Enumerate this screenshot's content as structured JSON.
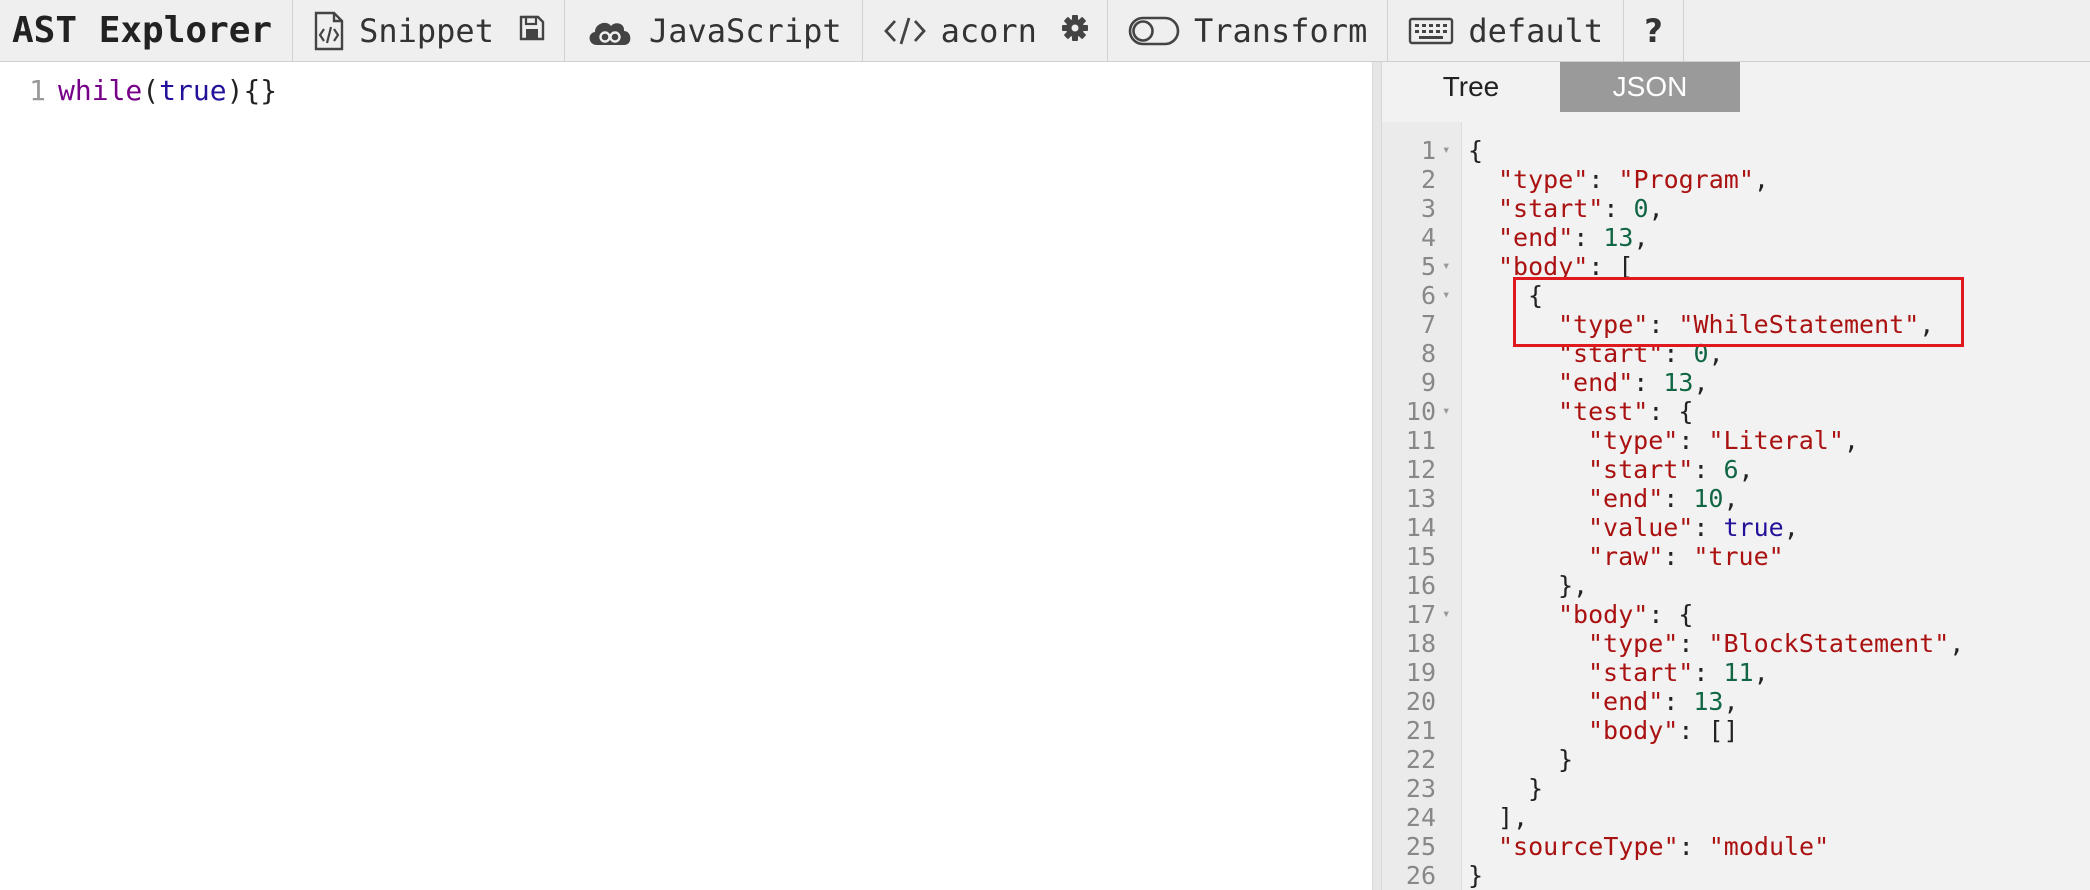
{
  "toolbar": {
    "brand": "AST Explorer",
    "snippet_label": "Snippet",
    "language_label": "JavaScript",
    "parser_label": "acorn",
    "transform_label": "Transform",
    "keymap_label": "default",
    "help_label": "?",
    "icons": [
      "file-code-icon",
      "save-icon",
      "cloud-icon",
      "code-brackets-icon",
      "gear-icon",
      "toggle-icon",
      "keyboard-icon",
      "help-icon"
    ]
  },
  "editor": {
    "lines": [
      {
        "number": "1",
        "tokens": [
          {
            "text": "while",
            "kind": "keyword"
          },
          {
            "text": "(",
            "kind": "punc"
          },
          {
            "text": "true",
            "kind": "atom"
          },
          {
            "text": "){}",
            "kind": "punc"
          }
        ]
      }
    ]
  },
  "output": {
    "tabs": [
      {
        "label": "Tree",
        "active": false
      },
      {
        "label": "JSON",
        "active": true
      }
    ],
    "json_lines": [
      {
        "n": "1",
        "fold": true,
        "indent": 0,
        "parts": [
          [
            "{",
            "p"
          ]
        ]
      },
      {
        "n": "2",
        "fold": false,
        "indent": 1,
        "parts": [
          [
            "\"type\"",
            "k"
          ],
          [
            ": ",
            "p"
          ],
          [
            "\"Program\"",
            "s"
          ],
          [
            ",",
            "p"
          ]
        ]
      },
      {
        "n": "3",
        "fold": false,
        "indent": 1,
        "parts": [
          [
            "\"start\"",
            "k"
          ],
          [
            ": ",
            "p"
          ],
          [
            "0",
            "n"
          ],
          [
            ",",
            "p"
          ]
        ]
      },
      {
        "n": "4",
        "fold": false,
        "indent": 1,
        "parts": [
          [
            "\"end\"",
            "k"
          ],
          [
            ": ",
            "p"
          ],
          [
            "13",
            "n"
          ],
          [
            ",",
            "p"
          ]
        ]
      },
      {
        "n": "5",
        "fold": true,
        "indent": 1,
        "parts": [
          [
            "\"body\"",
            "k"
          ],
          [
            ": [",
            "p"
          ]
        ]
      },
      {
        "n": "6",
        "fold": true,
        "indent": 2,
        "parts": [
          [
            "{",
            "p"
          ]
        ]
      },
      {
        "n": "7",
        "fold": false,
        "indent": 3,
        "parts": [
          [
            "\"type\"",
            "k"
          ],
          [
            ": ",
            "p"
          ],
          [
            "\"WhileStatement\"",
            "s"
          ],
          [
            ",",
            "p"
          ]
        ]
      },
      {
        "n": "8",
        "fold": false,
        "indent": 3,
        "parts": [
          [
            "\"start\"",
            "k"
          ],
          [
            ": ",
            "p"
          ],
          [
            "0",
            "n"
          ],
          [
            ",",
            "p"
          ]
        ]
      },
      {
        "n": "9",
        "fold": false,
        "indent": 3,
        "parts": [
          [
            "\"end\"",
            "k"
          ],
          [
            ": ",
            "p"
          ],
          [
            "13",
            "n"
          ],
          [
            ",",
            "p"
          ]
        ]
      },
      {
        "n": "10",
        "fold": true,
        "indent": 3,
        "parts": [
          [
            "\"test\"",
            "k"
          ],
          [
            ": {",
            "p"
          ]
        ]
      },
      {
        "n": "11",
        "fold": false,
        "indent": 4,
        "parts": [
          [
            "\"type\"",
            "k"
          ],
          [
            ": ",
            "p"
          ],
          [
            "\"Literal\"",
            "s"
          ],
          [
            ",",
            "p"
          ]
        ]
      },
      {
        "n": "12",
        "fold": false,
        "indent": 4,
        "parts": [
          [
            "\"start\"",
            "k"
          ],
          [
            ": ",
            "p"
          ],
          [
            "6",
            "n"
          ],
          [
            ",",
            "p"
          ]
        ]
      },
      {
        "n": "13",
        "fold": false,
        "indent": 4,
        "parts": [
          [
            "\"end\"",
            "k"
          ],
          [
            ": ",
            "p"
          ],
          [
            "10",
            "n"
          ],
          [
            ",",
            "p"
          ]
        ]
      },
      {
        "n": "14",
        "fold": false,
        "indent": 4,
        "parts": [
          [
            "\"value\"",
            "k"
          ],
          [
            ": ",
            "p"
          ],
          [
            "true",
            "a"
          ],
          [
            ",",
            "p"
          ]
        ]
      },
      {
        "n": "15",
        "fold": false,
        "indent": 4,
        "parts": [
          [
            "\"raw\"",
            "k"
          ],
          [
            ": ",
            "p"
          ],
          [
            "\"true\"",
            "s"
          ]
        ]
      },
      {
        "n": "16",
        "fold": false,
        "indent": 3,
        "parts": [
          [
            "},",
            "p"
          ]
        ]
      },
      {
        "n": "17",
        "fold": true,
        "indent": 3,
        "parts": [
          [
            "\"body\"",
            "k"
          ],
          [
            ": {",
            "p"
          ]
        ]
      },
      {
        "n": "18",
        "fold": false,
        "indent": 4,
        "parts": [
          [
            "\"type\"",
            "k"
          ],
          [
            ": ",
            "p"
          ],
          [
            "\"BlockStatement\"",
            "s"
          ],
          [
            ",",
            "p"
          ]
        ]
      },
      {
        "n": "19",
        "fold": false,
        "indent": 4,
        "parts": [
          [
            "\"start\"",
            "k"
          ],
          [
            ": ",
            "p"
          ],
          [
            "11",
            "n"
          ],
          [
            ",",
            "p"
          ]
        ]
      },
      {
        "n": "20",
        "fold": false,
        "indent": 4,
        "parts": [
          [
            "\"end\"",
            "k"
          ],
          [
            ": ",
            "p"
          ],
          [
            "13",
            "n"
          ],
          [
            ",",
            "p"
          ]
        ]
      },
      {
        "n": "21",
        "fold": false,
        "indent": 4,
        "parts": [
          [
            "\"body\"",
            "k"
          ],
          [
            ": []",
            "p"
          ]
        ]
      },
      {
        "n": "22",
        "fold": false,
        "indent": 3,
        "parts": [
          [
            "}",
            "p"
          ]
        ]
      },
      {
        "n": "23",
        "fold": false,
        "indent": 2,
        "parts": [
          [
            "}",
            "p"
          ]
        ]
      },
      {
        "n": "24",
        "fold": false,
        "indent": 1,
        "parts": [
          [
            "],",
            "p"
          ]
        ]
      },
      {
        "n": "25",
        "fold": false,
        "indent": 1,
        "parts": [
          [
            "\"sourceType\"",
            "k"
          ],
          [
            ": ",
            "p"
          ],
          [
            "\"module\"",
            "s"
          ]
        ]
      },
      {
        "n": "26",
        "fold": false,
        "indent": 0,
        "parts": [
          [
            "}",
            "p"
          ]
        ]
      }
    ]
  },
  "annotation": {
    "color": "#e0191f"
  }
}
